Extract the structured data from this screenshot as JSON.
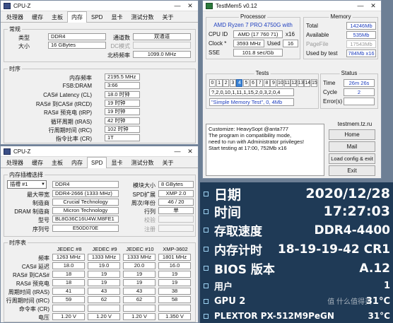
{
  "cpuz_top": {
    "title": "CPU-Z",
    "tabs": [
      "处理器",
      "缓存",
      "主板",
      "内存",
      "SPD",
      "显卡",
      "测试分数",
      "关于"
    ],
    "active_tab": "内存",
    "general": {
      "group_title": "常规",
      "type_label": "类型",
      "type_value": "DDR4",
      "size_label": "大小",
      "size_value": "16 GBytes",
      "channel_label": "通道数",
      "channel_value": "双通道",
      "dc_label": "DC模式",
      "dc_value": "",
      "nb_label": "北桥频率",
      "nb_value": "1099.0 MHz"
    },
    "timing": {
      "group_title": "时序",
      "rows": [
        {
          "label": "内存频率",
          "value": "2195.5 MHz"
        },
        {
          "label": "FSB:DRAM",
          "value": "3:66"
        },
        {
          "label": "CAS# Latency (CL)",
          "value": "18.0 时钟"
        },
        {
          "label": "RAS# 到CAS# (tRCD)",
          "value": "19 时钟"
        },
        {
          "label": "RAS# 预充电 (tRP)",
          "value": "19 时钟"
        },
        {
          "label": "循环周期 (tRAS)",
          "value": "42 时钟"
        },
        {
          "label": "行周期时间 (tRC)",
          "value": "102 时钟"
        },
        {
          "label": "指令比率 (CR)",
          "value": "1T"
        }
      ]
    }
  },
  "cpuz_bottom": {
    "title": "CPU-Z",
    "tabs": [
      "处理器",
      "缓存",
      "主板",
      "内存",
      "SPD",
      "显卡",
      "测试分数",
      "关于"
    ],
    "active_tab": "SPD",
    "slot_group_title": "内存插槽选择",
    "slot_select": "插槽 #1",
    "slot_type": "DDR4",
    "module_size_label": "模块大小",
    "module_size_value": "8 GBytes",
    "max_bw_label": "最大带宽",
    "max_bw_value": "DDR4-2666 (1333 MHz)",
    "spd_ext_label": "SPD扩展",
    "spd_ext_value": "XMP 2.0",
    "manufacturer_label": "制造商",
    "manufacturer_value": "Crucial Technology",
    "week_year_label": "周次/年份",
    "week_year_value": "46 / 20",
    "dram_mfr_label": "DRAM 制造商",
    "dram_mfr_value": "Micron Technology",
    "ranks_label": "行列",
    "ranks_value": "单",
    "model_label": "型号",
    "model_value": "BL8G36C16U4W.M8FE1",
    "verify_label": "校验",
    "verify_value": "",
    "serial_label": "序列号",
    "serial_value": "E50D070E",
    "registered_label": "注册",
    "registered_value": "",
    "timing_table": {
      "group_title": "时序表",
      "headers": [
        "JEDEC #8",
        "JEDEC #9",
        "JEDEC #10",
        "XMP-3602"
      ],
      "rows": [
        {
          "label": "频率",
          "values": [
            "1263 MHz",
            "1333 MHz",
            "1333 MHz",
            "1801 MHz"
          ]
        },
        {
          "label": "CAS# 延迟",
          "values": [
            "18.0",
            "19.0",
            "20.0",
            "16.0"
          ]
        },
        {
          "label": "RAS# 到CAS#",
          "values": [
            "18",
            "19",
            "19",
            "19"
          ]
        },
        {
          "label": "RAS# 预充电",
          "values": [
            "18",
            "19",
            "19",
            "19"
          ]
        },
        {
          "label": "周期时间 (tRAS)",
          "values": [
            "41",
            "43",
            "43",
            "38"
          ]
        },
        {
          "label": "行周期时间 (tRC)",
          "values": [
            "59",
            "62",
            "62",
            "58"
          ]
        },
        {
          "label": "命令率 (CR)",
          "values": [
            "",
            "",
            "",
            ""
          ]
        },
        {
          "label": "电压",
          "values": [
            "1.20 V",
            "1.20 V",
            "1.20 V",
            "1.350 V"
          ]
        }
      ]
    }
  },
  "testmem": {
    "title": "TestMem5 v0.12",
    "processor_title": "Processor",
    "processor_name": "AMD Ryzen 7 PRO 4750G with",
    "cpu_id_label": "CPU ID",
    "cpu_id_value": "AMD (17 760 71)",
    "cpu_id_threads": "x16",
    "clock_label": "Clock *",
    "clock_value": "3593 MHz",
    "used_label": "Used",
    "used_value": "16",
    "sse_label": "SSE",
    "sse_value": "101.8 sec/Gb",
    "memory_title": "Memory",
    "total_label": "Total",
    "total_value": "14246Mb",
    "available_label": "Available",
    "available_value": "535Mb",
    "pagefile_label": "PageFile",
    "pagefile_value": "17543Mb",
    "usedby_label": "Used by test",
    "usedby_value": "784Mb x16",
    "tests_title": "Tests",
    "test_numbers": [
      "0",
      "1",
      "2",
      "3",
      "4",
      "5",
      "6",
      "7",
      "8",
      "9",
      "10",
      "11",
      "12",
      "13",
      "14",
      "15"
    ],
    "current_test": "4",
    "sequence": "?,2,0,10,1,11,1,15,2,0,3,2,0,4",
    "test_name": "\"Simple Memory Test\", 0, 4Mb",
    "status_title": "Status",
    "time_label": "Time",
    "time_value": "26m 26s",
    "cycle_label": "Cycle",
    "cycle_value": "2",
    "errors_label": "Error(s)",
    "errors_value": "",
    "log": "Customize: HeavySopt @anta777\nThe program in compatibility mode,\nneed to run with Administrator privileges!\nStart testing at 17:00, 752Mb x16",
    "site": "testmem.tz.ru",
    "buttons": [
      "Home",
      "Mail",
      "Load config & exit",
      "Exit"
    ]
  },
  "overlay": {
    "rows": [
      {
        "label": "日期",
        "value": "2020/12/28"
      },
      {
        "label": "时间",
        "value": "17:27:03"
      },
      {
        "label": "存取速度",
        "value": "DDR4-4400"
      },
      {
        "label": "内存计时",
        "value": "18-19-19-42 CR1"
      },
      {
        "label": "BIOS 版本",
        "value": "A.12"
      },
      {
        "label": "用户",
        "value": "1"
      },
      {
        "label": "GPU 2",
        "value": "31°C"
      },
      {
        "label": "PLEXTOR PX-512M9PeGN",
        "value": "31°C"
      }
    ],
    "watermark": "值 什么值得买"
  }
}
